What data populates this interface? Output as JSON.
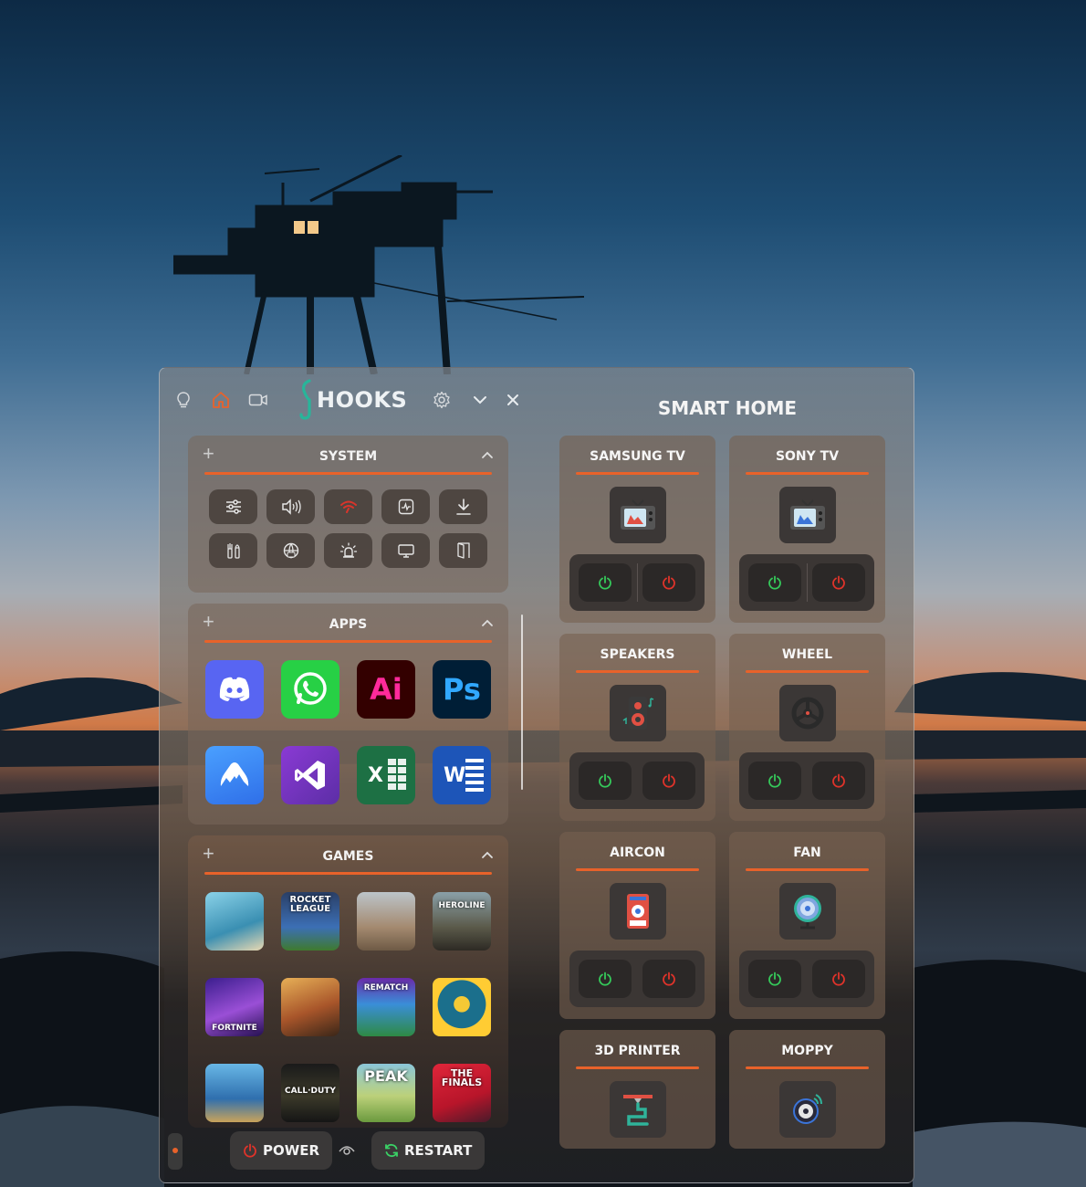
{
  "app": {
    "brand": "HOOKS"
  },
  "titlebar": {
    "icons": [
      "lightbulb-icon",
      "home-icon",
      "camera-icon",
      "settings-icon",
      "chevron-down-icon",
      "close-icon"
    ],
    "accent": "#e8622a",
    "brand_color": "#28b59a"
  },
  "panels": {
    "system": {
      "title": "SYSTEM",
      "buttons": [
        "sliders-icon",
        "volume-icon",
        "wifi-icon",
        "activity-monitor-icon",
        "download-icon",
        "tools-icon",
        "globe-icon",
        "alarm-light-icon",
        "monitor-icon",
        "door-icon"
      ]
    },
    "apps": {
      "title": "APPS",
      "items": [
        {
          "name": "Discord",
          "label": ""
        },
        {
          "name": "WhatsApp",
          "label": ""
        },
        {
          "name": "Adobe Illustrator",
          "label": "Ai"
        },
        {
          "name": "Adobe Photoshop",
          "label": "Ps"
        },
        {
          "name": "NordVPN",
          "label": ""
        },
        {
          "name": "Visual Studio",
          "label": ""
        },
        {
          "name": "Excel",
          "label": "X"
        },
        {
          "name": "Word",
          "label": "W"
        }
      ]
    },
    "games": {
      "title": "GAMES",
      "items": [
        {
          "name": "sea-game",
          "label": ""
        },
        {
          "name": "rocket-league",
          "label": "ROCKET LEAGUE"
        },
        {
          "name": "dune-game",
          "label": ""
        },
        {
          "name": "heroline",
          "label": "HEROLINE"
        },
        {
          "name": "fortnite",
          "label": "FORTNITE"
        },
        {
          "name": "deliver-game",
          "label": ""
        },
        {
          "name": "rematch",
          "label": "REMATCH"
        },
        {
          "name": "sun-game",
          "label": ""
        },
        {
          "name": "tony-hawk",
          "label": ""
        },
        {
          "name": "call-of-duty",
          "label": "CALL·DUTY"
        },
        {
          "name": "peak",
          "label": "PEAK"
        },
        {
          "name": "the-finals",
          "label": "THE FINALS"
        }
      ]
    }
  },
  "footer": {
    "power_label": "POWER",
    "restart_label": "RESTART"
  },
  "smart_home": {
    "title": "SMART HOME",
    "devices": [
      {
        "name": "SAMSUNG TV",
        "icon": "tv-icon"
      },
      {
        "name": "SONY TV",
        "icon": "tv-icon"
      },
      {
        "name": "SPEAKERS",
        "icon": "speaker-icon"
      },
      {
        "name": "WHEEL",
        "icon": "steering-wheel-icon"
      },
      {
        "name": "AIRCON",
        "icon": "aircon-icon"
      },
      {
        "name": "FAN",
        "icon": "fan-icon"
      },
      {
        "name": "3D PRINTER",
        "icon": "printer-3d-icon"
      },
      {
        "name": "MOPPY",
        "icon": "robot-vacuum-icon"
      }
    ]
  }
}
